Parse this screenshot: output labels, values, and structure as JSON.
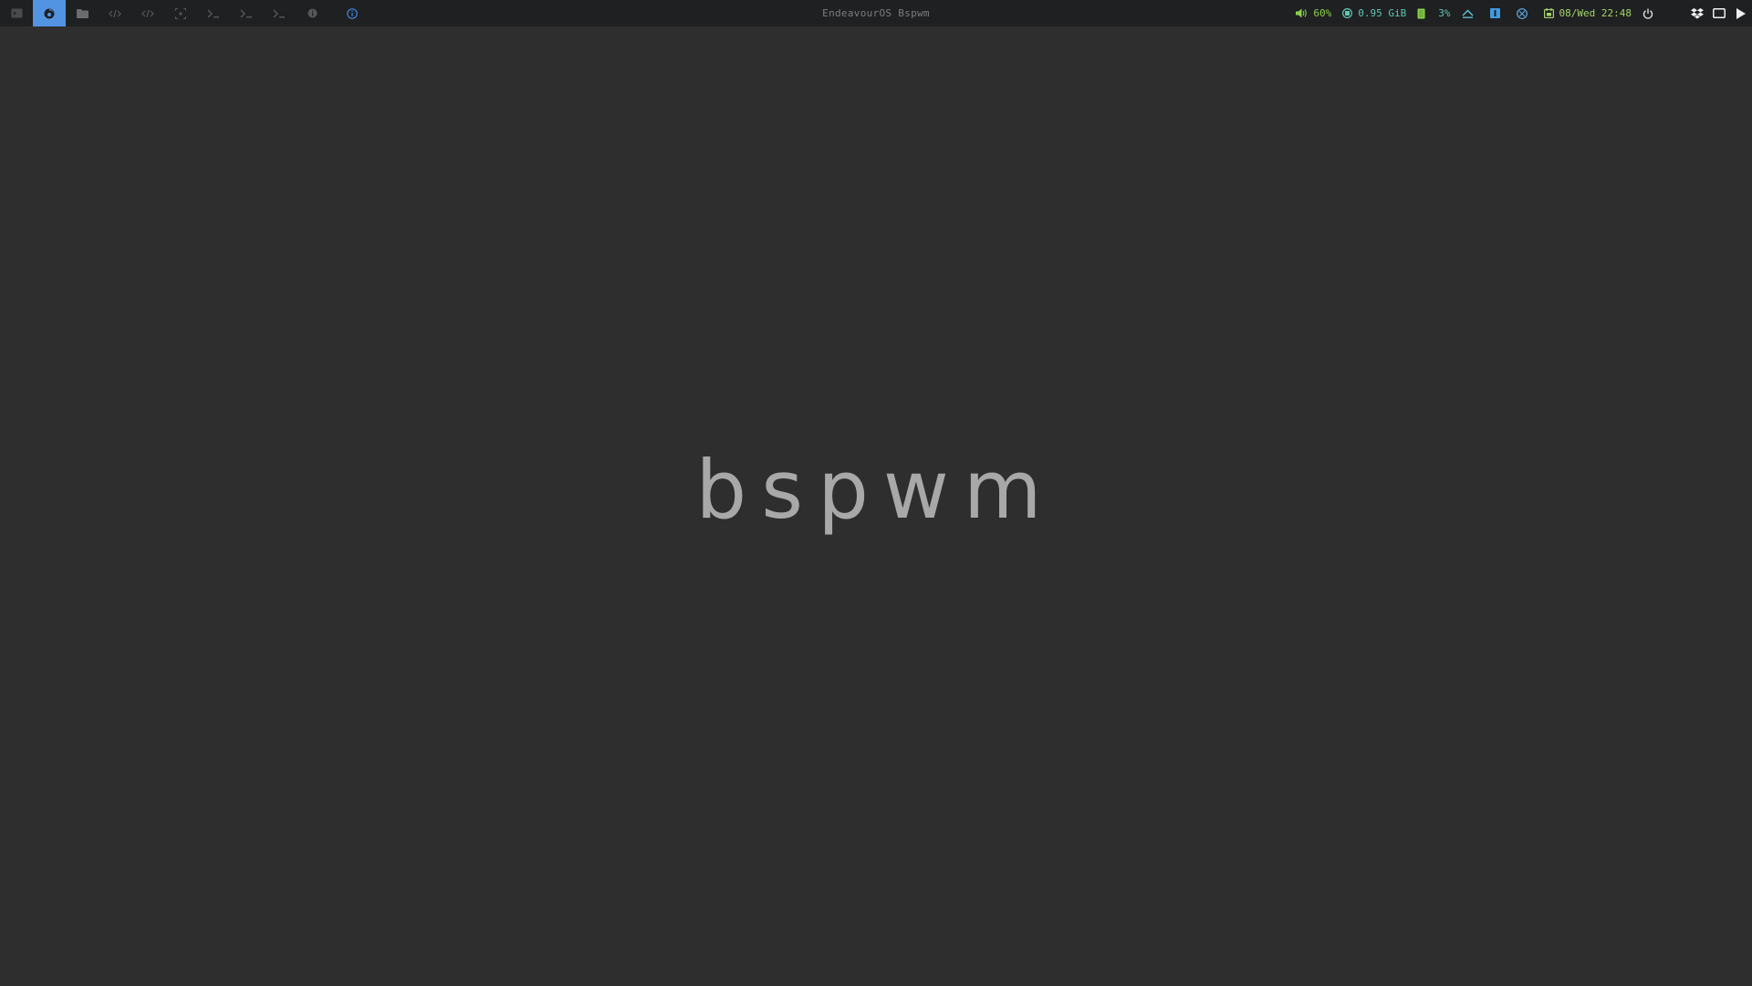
{
  "bar": {
    "title": "EndeavourOS Bspwm",
    "workspaces": [
      {
        "icon": "terminal-icon",
        "active": false
      },
      {
        "icon": "firefox-icon",
        "active": true
      },
      {
        "icon": "folder-icon",
        "active": false
      },
      {
        "icon": "code-icon",
        "active": false
      },
      {
        "icon": "code-icon",
        "active": false
      },
      {
        "icon": "screenshot-icon",
        "active": false
      },
      {
        "icon": "prompt-icon",
        "active": false
      },
      {
        "icon": "prompt-icon",
        "active": false
      },
      {
        "icon": "prompt-icon",
        "active": false
      },
      {
        "icon": "info-circle-icon",
        "active": false
      }
    ],
    "info_icon": "info-icon",
    "modules": {
      "volume": {
        "icon": "speaker-icon",
        "value": "60%",
        "color": "#8bd14a"
      },
      "memory": {
        "icon": "memory-icon",
        "value": "0.95 GiB",
        "color": "#5fc8b4"
      },
      "cpu": {
        "icon": "cpu-icon",
        "value": "3%",
        "color": "#5fc8b4"
      },
      "updates": {
        "icon": "updates-icon"
      },
      "network": {
        "icon": "network-icon"
      },
      "bug": {
        "icon": "bug-icon"
      },
      "date": {
        "icon": "calendar-icon",
        "value": "08/Wed 22:48",
        "color": "#a4d46a"
      },
      "power": {
        "icon": "power-icon"
      }
    },
    "tray": [
      "dropbox-icon",
      "display-icon",
      "play-icon"
    ]
  },
  "desktop": {
    "label": "bspwm"
  },
  "colors": {
    "bar_bg": "#1f2022",
    "desktop_bg": "#2e2e2e",
    "accent": "#5294e2"
  }
}
